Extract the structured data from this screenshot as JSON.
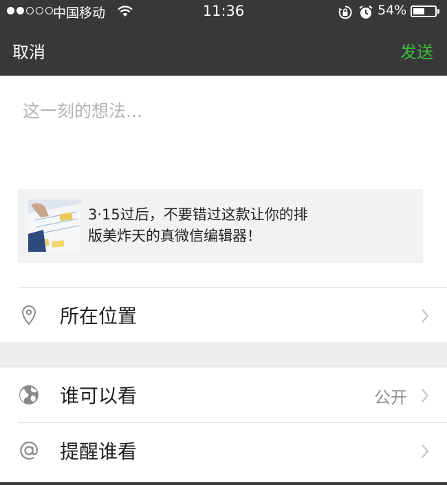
{
  "status_bar": {
    "carrier": "中国移动",
    "time": "11:36",
    "battery": "54%",
    "battery_level": 0.54,
    "signal_bars_filled": 2,
    "signal_bars_total": 5
  },
  "nav": {
    "cancel_label": "取消",
    "send_label": "发送",
    "send_color": "#3dbb3a"
  },
  "compose": {
    "placeholder": "这一刻的想法..."
  },
  "share_card": {
    "line1": "3·15过后，不要错过这款让你的排",
    "line2": "版美炸天的真微信编辑器！",
    "thumbnail_icon": "article-thumbnail"
  },
  "options": {
    "location": {
      "label": "所在位置",
      "icon": "location-pin-icon"
    },
    "visibility": {
      "label": "谁可以看",
      "value": "公开",
      "icon": "globe-icon"
    },
    "mention": {
      "label": "提醒谁看",
      "icon": "at-icon"
    }
  }
}
